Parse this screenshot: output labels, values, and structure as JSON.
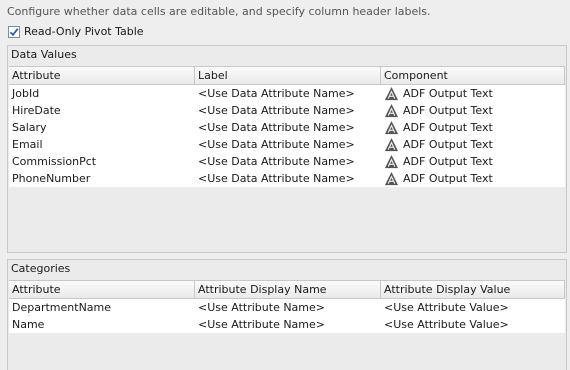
{
  "description": "Configure whether data cells are editable, and specify column header labels.",
  "readonly_checkbox": {
    "label": "Read-Only Pivot Table",
    "checked": true
  },
  "data_values": {
    "title": "Data Values",
    "headers": [
      "Attribute",
      "Label",
      "Component"
    ],
    "rows": [
      {
        "attribute": "JobId",
        "label": "<Use Data Attribute Name>",
        "component": "ADF Output Text",
        "icon": "adf-icon"
      },
      {
        "attribute": "HireDate",
        "label": "<Use Data Attribute Name>",
        "component": "ADF Output Text",
        "icon": "adf-icon"
      },
      {
        "attribute": "Salary",
        "label": "<Use Data Attribute Name>",
        "component": "ADF Output Text",
        "icon": "adf-icon"
      },
      {
        "attribute": "Email",
        "label": "<Use Data Attribute Name>",
        "component": "ADF Output Text",
        "icon": "adf-icon"
      },
      {
        "attribute": "CommissionPct",
        "label": "<Use Data Attribute Name>",
        "component": "ADF Output Text",
        "icon": "adf-icon"
      },
      {
        "attribute": "PhoneNumber",
        "label": "<Use Data Attribute Name>",
        "component": "ADF Output Text",
        "icon": "adf-icon"
      }
    ]
  },
  "categories": {
    "title": "Categories",
    "headers": [
      "Attribute",
      "Attribute Display Name",
      "Attribute Display Value"
    ],
    "rows": [
      {
        "attribute": "DepartmentName",
        "display_name": "<Use Attribute Name>",
        "display_value": "<Use Attribute Value>"
      },
      {
        "attribute": "Name",
        "display_name": "<Use Attribute Name>",
        "display_value": "<Use Attribute Value>"
      }
    ]
  },
  "colors": {
    "background": "#eeeeee",
    "grid_border": "#c8c8c8",
    "check_blue": "#2a5db0"
  }
}
